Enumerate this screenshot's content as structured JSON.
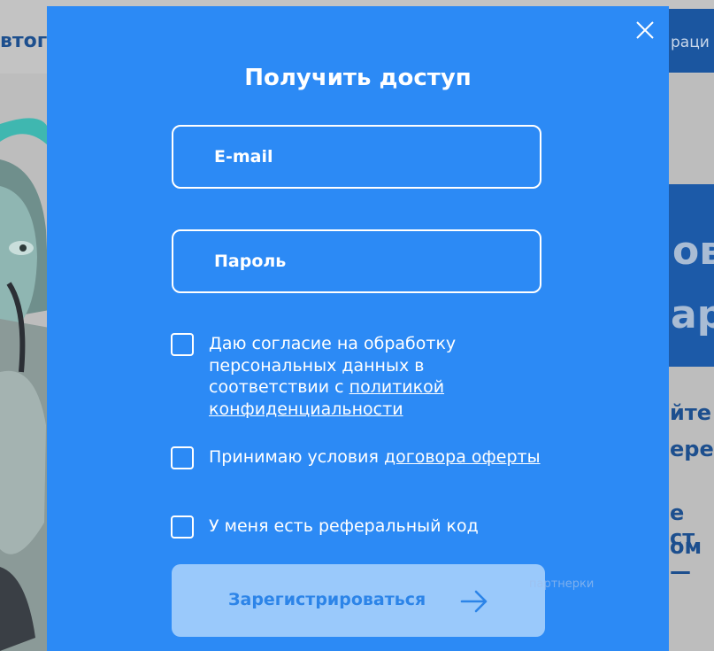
{
  "background": {
    "logo_fragment": "втог",
    "nav_fragment": "раци",
    "hero_line1": "ов",
    "hero_line2": "ар",
    "sub_line1": "йте",
    "sub_line2": "ереп",
    "sub_line3": "е ст",
    "sub_line4": "ом —"
  },
  "modal": {
    "close_icon": "close-icon",
    "title": "Получить доступ",
    "email_placeholder": "E-mail",
    "email_value": "",
    "password_placeholder": "Пароль",
    "password_value": "",
    "consent": {
      "text": "Даю согласие на обработку персональных данных в соответствии с ",
      "link": "политикой конфиденциальности",
      "checked": false
    },
    "offer": {
      "text": "Принимаю условия ",
      "link": "договора оферты",
      "checked": false
    },
    "referral": {
      "text": "У меня есть реферальный код",
      "checked": false
    },
    "submit_label": "Зарегистрироваться",
    "submit_icon": "arrow-right-icon",
    "watermark": "партнерки"
  },
  "colors": {
    "modal_bg": "#2c8af5",
    "button_bg": "#9ac9fb",
    "button_text": "#2c84e8",
    "text": "#ffffff"
  }
}
